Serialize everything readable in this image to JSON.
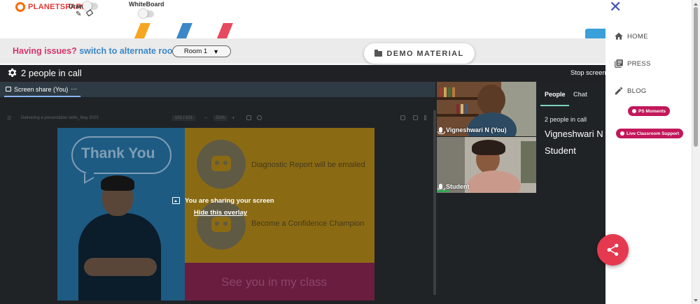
{
  "top_bar": {
    "logo_text": "PLANETSPARK",
    "draw_label": "Draw",
    "whiteboard_label": "WhiteBoard",
    "pencil_icon": "pencil-icon",
    "eraser_icon": "eraser-icon"
  },
  "issues_bar": {
    "question": "Having issues?",
    "switch_link": "switch to alternate room",
    "room_selected": "Room 1",
    "demo_button": "DEMO MATERIAL"
  },
  "meet": {
    "header_title": "2 people in call",
    "stop_screen": "Stop screen",
    "share_tab": "Screen share (You)",
    "share_tab_more": "⋯",
    "slide_toolbar": {
      "doc_title": "Delivering a presentation skills_May 2023",
      "page": "101 / 101",
      "zoom": "51%",
      "minus": "−",
      "plus": "+"
    },
    "slide": {
      "thank_you": "Thank You",
      "line1": "Diagnostic Report will be emailed",
      "line2": "Become a Confidence Champion",
      "see_you": "See you in my class"
    },
    "overlay": {
      "message": "You are sharing your screen",
      "hide_link": "Hide this overlay"
    },
    "tiles": [
      {
        "name": "Vigneshwari N (You)"
      },
      {
        "name": "Student"
      }
    ],
    "panel": {
      "tab_people": "People",
      "tab_chat": "Chat",
      "count": "2 people in call",
      "participants": [
        "Vigneshwari N (",
        "Student"
      ]
    }
  },
  "sidebar": {
    "items": [
      {
        "label": "HOME",
        "icon": "home-icon"
      },
      {
        "label": "PRESS",
        "icon": "newspaper-icon"
      },
      {
        "label": "BLOG",
        "icon": "pencil-icon"
      }
    ],
    "ps_moments": "PS Moments",
    "live_support": "Live Classroom Support",
    "share_fab_icon": "share-icon"
  },
  "colors": {
    "brand_pink": "#d6336c",
    "link_blue": "#3a88c8",
    "meet_bg": "#1f2326",
    "accent_teal": "#7dd3c0",
    "fab_red": "#e53950",
    "pill": "#c2185b"
  }
}
